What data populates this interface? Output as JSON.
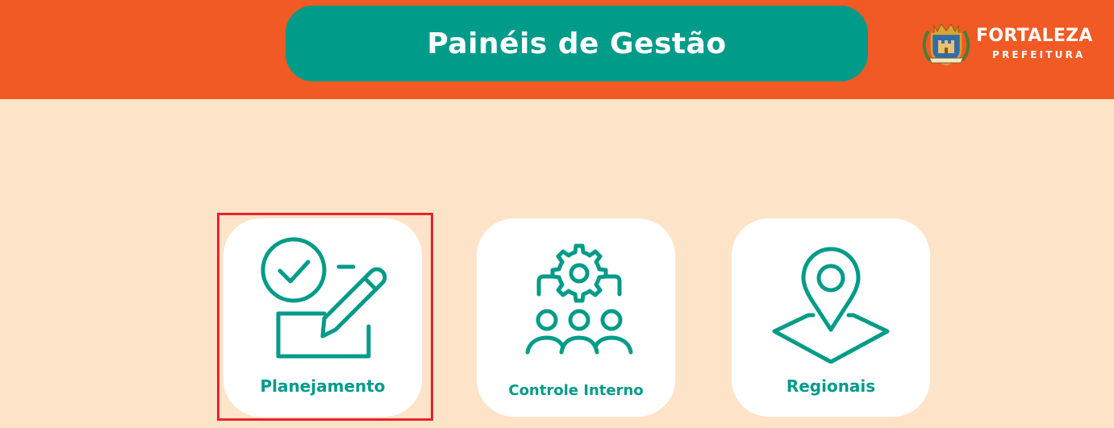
{
  "header": {
    "title": "Painéis de Gestão",
    "logo": {
      "name": "FORTALEZA",
      "subtitle": "PREFEITURA",
      "emblem_icon": "coat-of-arms-icon"
    }
  },
  "cards": [
    {
      "label": "Planejamento",
      "icon": "checklist-edit-icon"
    },
    {
      "label": "Controle Interno",
      "icon": "team-gear-icon"
    },
    {
      "label": "Regionais",
      "icon": "map-pin-icon"
    }
  ],
  "colors": {
    "header_bg": "#f15a24",
    "page_bg": "#fde4c9",
    "accent": "#009b89",
    "card_bg": "#ffffff",
    "highlight": "#e8232b"
  }
}
